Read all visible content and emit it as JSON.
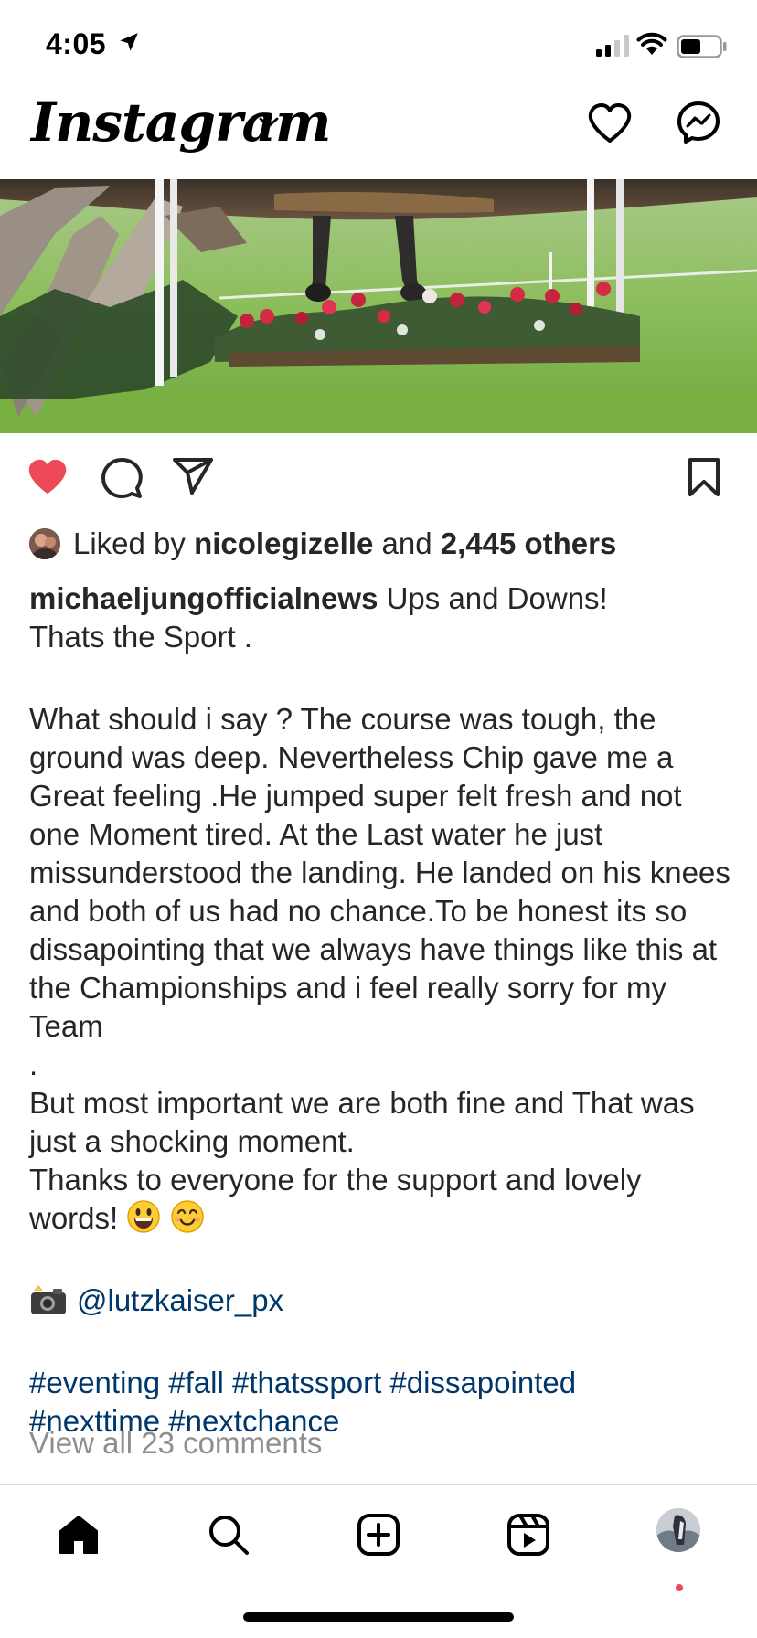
{
  "status_bar": {
    "time": "4:05"
  },
  "nav": {
    "logo": "Instagram"
  },
  "icons": {
    "location": "location-arrow-icon",
    "signal": "cellular-signal-icon",
    "wifi": "wifi-icon",
    "battery": "battery-icon",
    "chevron": "chevron-down-icon",
    "activity": "heart-icon",
    "messenger": "messenger-icon",
    "like": "heart-filled-icon",
    "comment": "comment-icon",
    "share": "share-icon",
    "save": "bookmark-icon",
    "home": "home-icon",
    "search": "search-icon",
    "create": "add-post-icon",
    "reels": "reels-icon",
    "profile": "profile-avatar"
  },
  "colors": {
    "like_red": "#ed4956",
    "link_blue": "#00376b",
    "muted_gray": "#8e8e8e",
    "text": "#262626"
  },
  "post": {
    "liked_by_prefix": "Liked by",
    "liked_by_user": "nicolegizelle",
    "liked_by_and": "and",
    "liked_by_others": "2,445 others",
    "username": "michaeljungofficialnews",
    "caption_first": "Ups and Downs!",
    "caption_line2": "Thats the Sport .",
    "caption_para": "What should i say ? The course was tough, the ground was deep. Nevertheless Chip gave me a Great feeling .He jumped super felt fresh and not one Moment tired. At the Last water he just missunderstood the landing. He landed on his knees and both of us had no chance.To be honest its so dissapointing that we always have things like this at the Championships and i feel really sorry for my Team",
    "caption_para_end": ".",
    "caption_line_fine": "But most important we are both fine and That was just a shocking moment.",
    "caption_thanks": "Thanks to everyone for the support and lovely words!",
    "photo_credit": "@lutzkaiser_px",
    "hashtags_line1": "#eventing #fall #thatssport #dissapointed",
    "hashtags_line2": "#nexttime #nextchance",
    "view_comments": "View all 23 comments"
  }
}
